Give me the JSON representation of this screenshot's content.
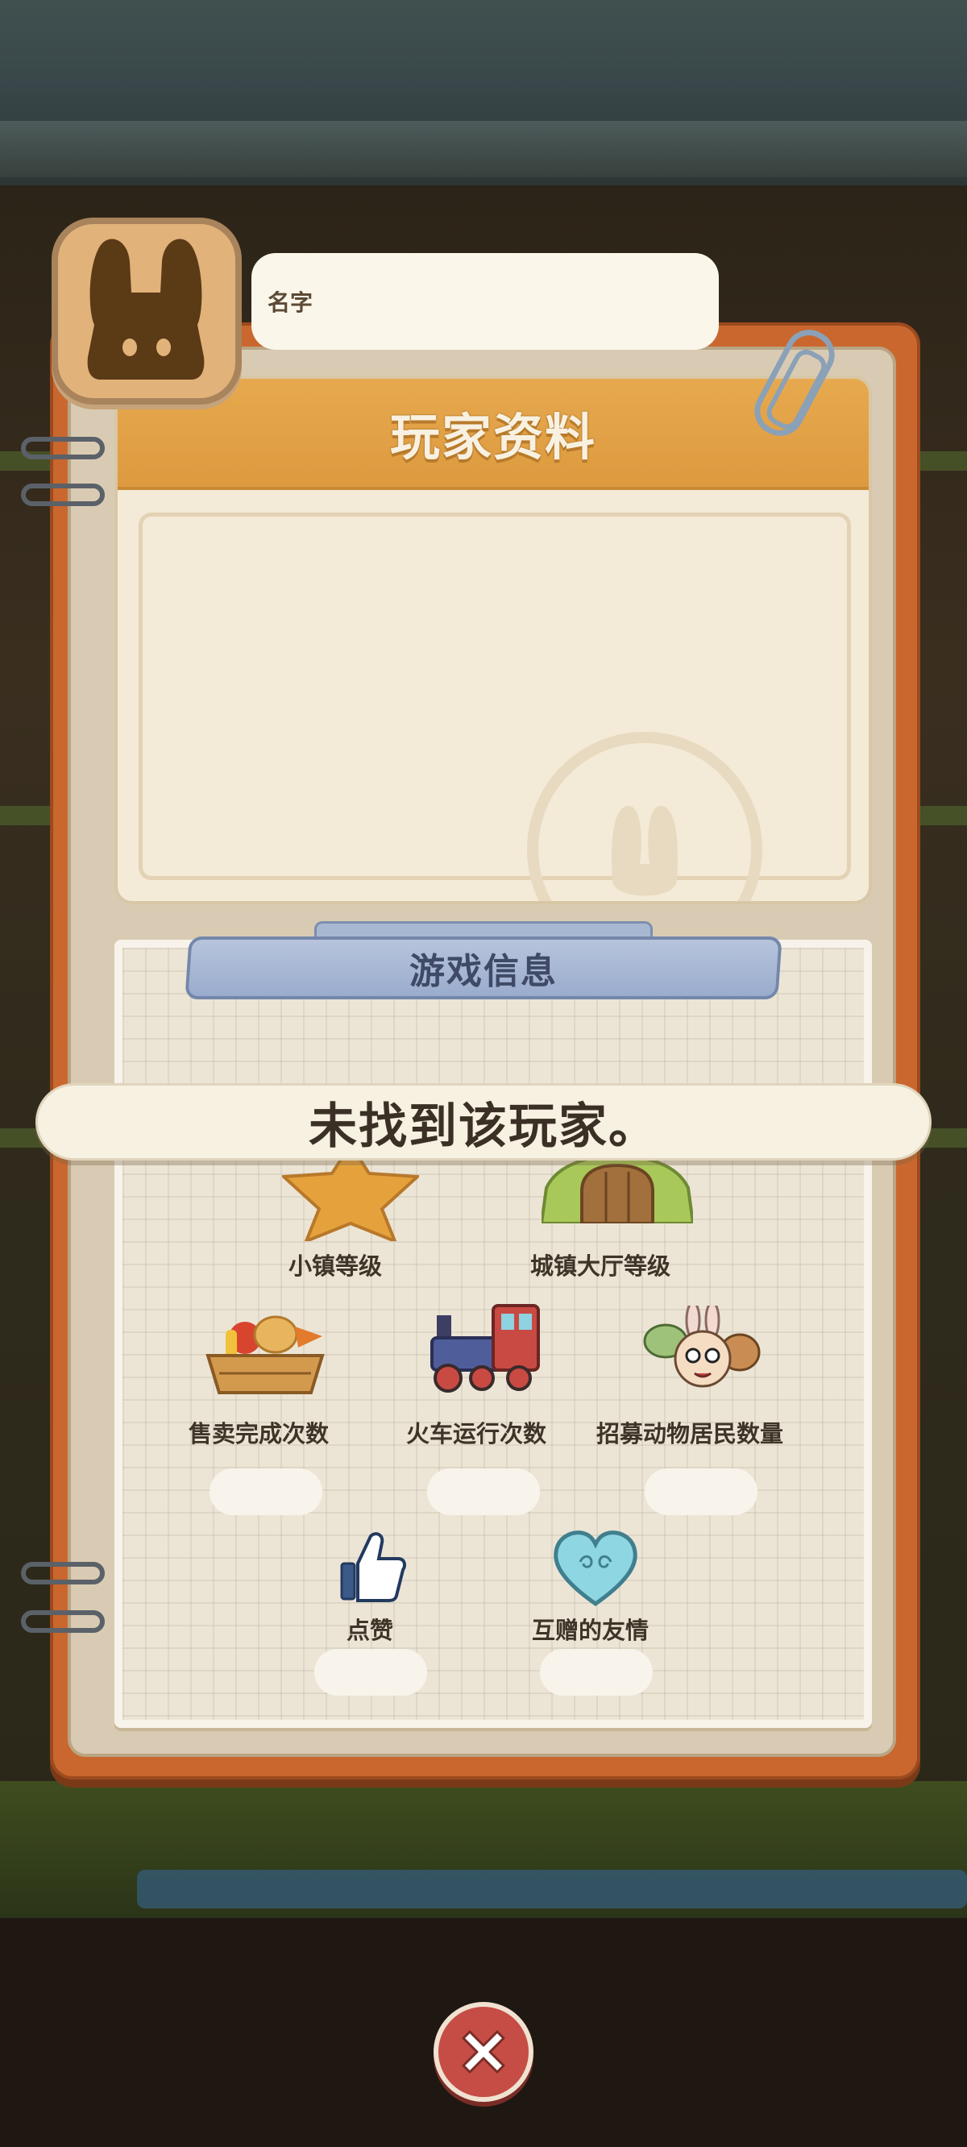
{
  "profile": {
    "title": "玩家资料",
    "name_label": "名字"
  },
  "game_info": {
    "title": "游戏信息",
    "stats": [
      {
        "label": "小镇等级",
        "icon": "star-icon"
      },
      {
        "label": "城镇大厅等级",
        "icon": "town-hall-door-icon"
      },
      {
        "label": "售卖完成次数",
        "icon": "produce-basket-icon"
      },
      {
        "label": "火车运行次数",
        "icon": "train-icon"
      },
      {
        "label": "招募动物居民数量",
        "icon": "animal-residents-icon"
      },
      {
        "label": "点赞",
        "icon": "thumbs-up-icon"
      },
      {
        "label": "互赠的友情",
        "icon": "heart-icon"
      }
    ]
  },
  "toast": {
    "message": "未找到该玩家。"
  },
  "colors": {
    "header_orange": "#dd9a3f",
    "cover_brown": "#c9672e",
    "banner_blue": "#9aaccd",
    "close_red": "#c54d46"
  }
}
